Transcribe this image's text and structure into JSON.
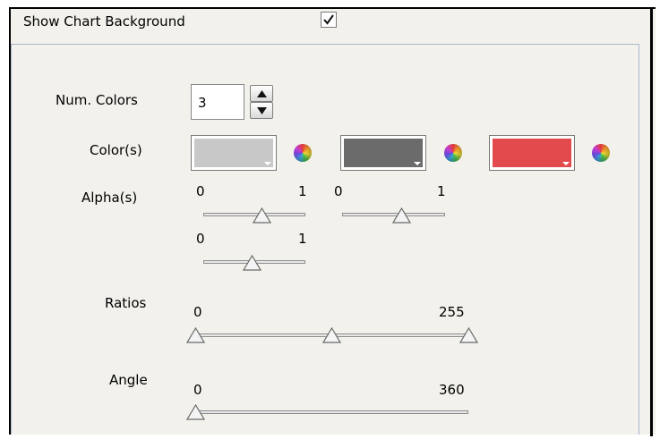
{
  "show_chart_background": {
    "label": "Show Chart Background",
    "checked": true
  },
  "num_colors": {
    "label": "Num. Colors",
    "value": "3"
  },
  "colors": {
    "label": "Color(s)",
    "swatches": [
      "#c8c8c8",
      "#6b6b6b",
      "#e24a4d"
    ]
  },
  "alphas": {
    "label": "Alpha(s)",
    "sliders": [
      {
        "min": "0",
        "max": "1",
        "value": 0.57
      },
      {
        "min": "0",
        "max": "1",
        "value": 0.57
      },
      {
        "min": "0",
        "max": "1",
        "value": 0.47
      }
    ]
  },
  "ratios": {
    "label": "Ratios",
    "min": "0",
    "max": "255",
    "values": [
      0,
      127,
      255
    ]
  },
  "angle": {
    "label": "Angle",
    "min": "0",
    "max": "360",
    "value": 0
  },
  "icons": [
    "checkmark-icon",
    "arrow-up-icon",
    "arrow-down-icon",
    "color-wheel-icon",
    "slider-thumb-icon"
  ],
  "colors_theme": {
    "background": "#f2f1ec",
    "panel_border": "#a9b9c8"
  }
}
